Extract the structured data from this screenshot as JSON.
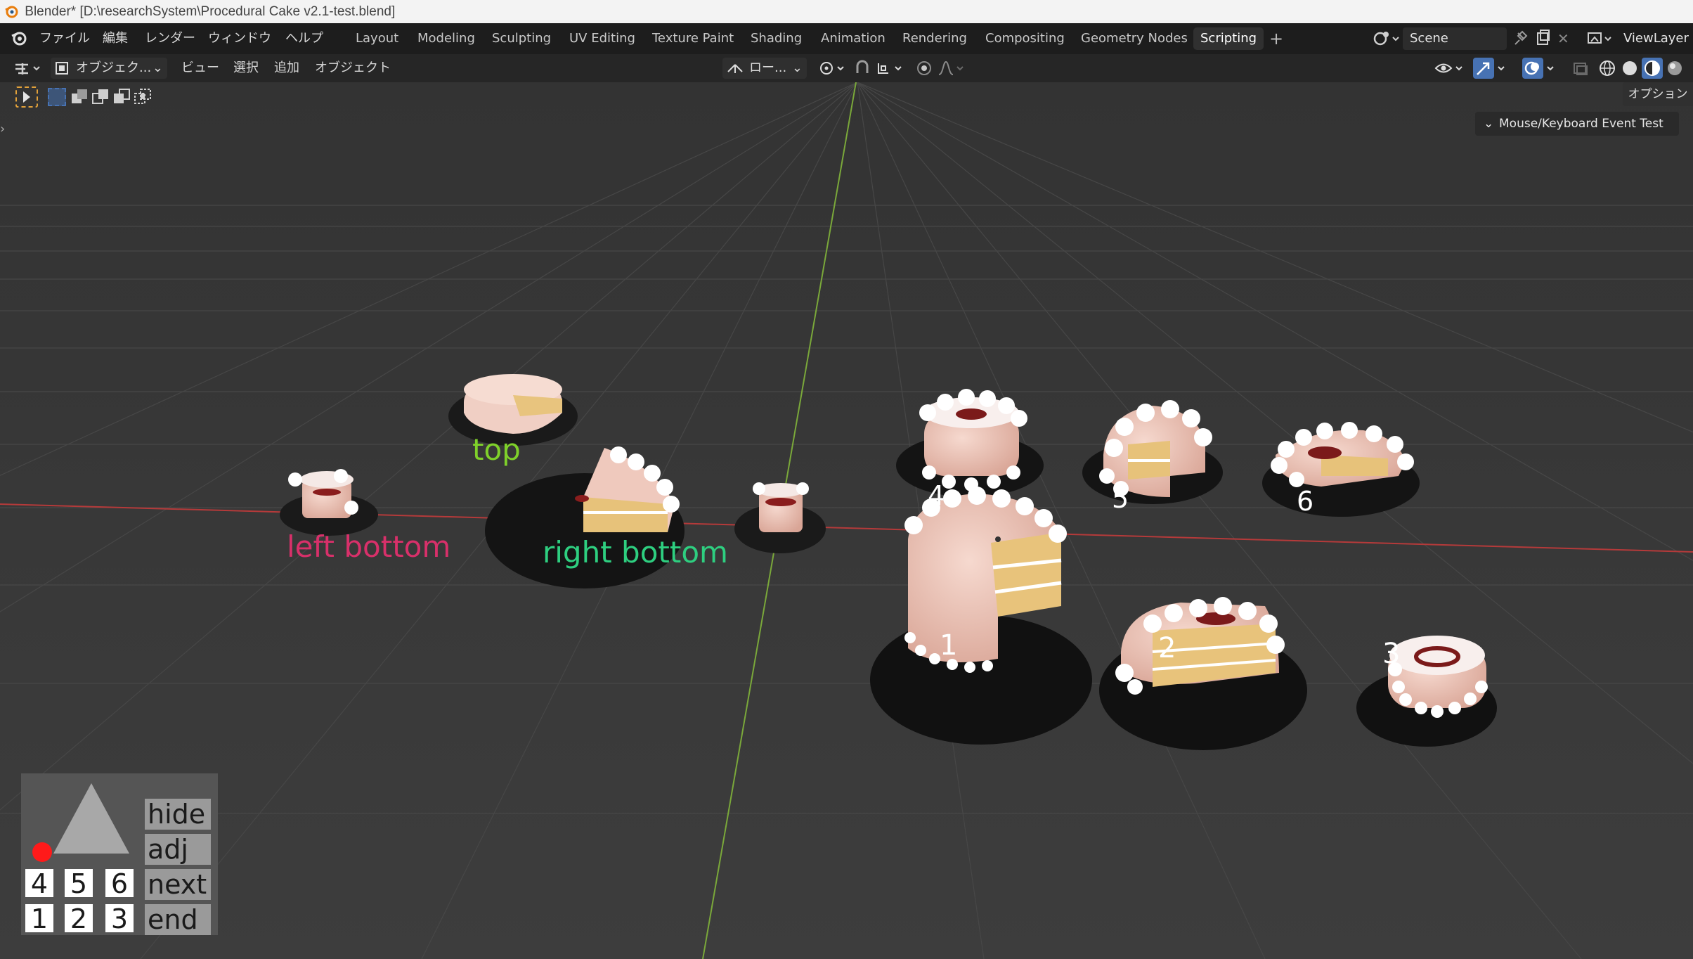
{
  "window": {
    "title": "Blender* [D:\\researchSystem\\Procedural Cake v2.1-test.blend]"
  },
  "menu": {
    "items": [
      "ファイル",
      "編集",
      "レンダー",
      "ウィンドウ",
      "ヘルプ"
    ]
  },
  "workspaces": {
    "tabs": [
      "Layout",
      "Modeling",
      "Sculpting",
      "UV Editing",
      "Texture Paint",
      "Shading",
      "Animation",
      "Rendering",
      "Compositing",
      "Geometry Nodes",
      "Scripting"
    ],
    "active": "Scripting"
  },
  "scene": {
    "name": "Scene"
  },
  "viewlayer": {
    "name": "ViewLayer"
  },
  "viewport_header": {
    "mode": "オブジェク...",
    "menus": [
      "ビュー",
      "選択",
      "追加",
      "オブジェクト"
    ],
    "transform_orientation": "ロー...",
    "options_label": "オプション"
  },
  "side_panel": {
    "tab_label": "Mouse/Keyboard Event Test"
  },
  "scene_labels": {
    "top": "top",
    "left_bottom": "left bottom",
    "right_bottom": "right bottom",
    "n1": "1",
    "n2": "2",
    "n3": "3",
    "n4": "4",
    "n5": "5",
    "n6": "6"
  },
  "colors": {
    "label_top": "#7fd12a",
    "label_left_bottom": "#d8306a",
    "label_right_bottom": "#2ecf80",
    "x_axis": "#b53a3a",
    "y_axis": "#7aa83a",
    "accent": "#4772b3"
  },
  "control_box": {
    "commands": [
      "hide",
      "adj",
      "next",
      "end"
    ],
    "row_top": [
      "4",
      "5",
      "6"
    ],
    "row_bottom": [
      "1",
      "2",
      "3"
    ]
  }
}
